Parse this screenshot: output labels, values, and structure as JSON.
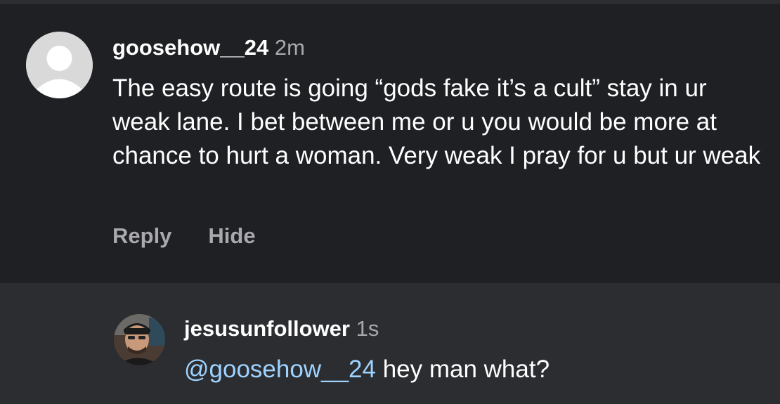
{
  "comment": {
    "username": "goosehow__24",
    "time": "2m",
    "text": "The easy route is going “gods fake it’s a cult” stay in ur weak lane. I bet between me or u you would be more at chance to hurt a woman. Very weak I pray for u but ur weak",
    "actions": {
      "reply_label": "Reply",
      "hide_label": "Hide"
    },
    "avatar_icon": "default-user-avatar-icon"
  },
  "reply": {
    "username": "jesusunfollower",
    "time": "1s",
    "mention": "@goosehow__24",
    "text": " hey man what?",
    "avatar_icon": "user-photo-avatar"
  },
  "colors": {
    "comment_background": "#1f2024",
    "reply_background": "#2b2d31",
    "text_primary": "#ffffff",
    "text_secondary": "#a8a8ad",
    "mention": "#9fd3ff"
  }
}
